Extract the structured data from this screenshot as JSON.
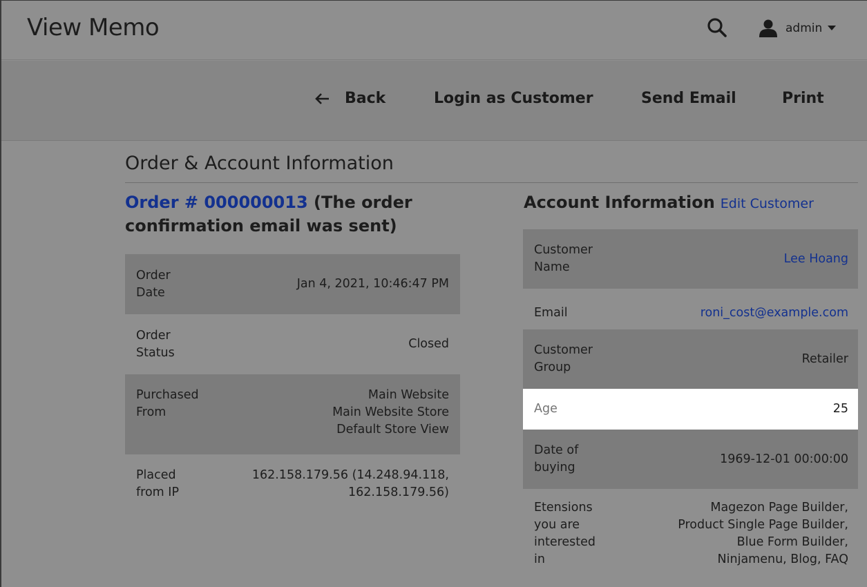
{
  "header": {
    "title": "View Memo",
    "search_icon": "search-icon",
    "user_name": "admin"
  },
  "actions": {
    "back": "Back",
    "login_as_customer": "Login as Customer",
    "send_email": "Send Email",
    "print": "Print"
  },
  "section": {
    "title": "Order & Account Information"
  },
  "order": {
    "link_text": "Order # 000000013",
    "note": " (The order confirmation email was sent)",
    "rows": [
      {
        "label": "Order Date",
        "value": "Jan 4, 2021, 10:46:47 PM"
      },
      {
        "label": "Order Status",
        "value": "Closed"
      },
      {
        "label": "Purchased From",
        "value": [
          "Main Website",
          "Main Website Store",
          "Default Store View"
        ]
      },
      {
        "label": "Placed from IP",
        "value": [
          "162.158.179.56 (14.248.94.118,",
          "162.158.179.56)"
        ]
      }
    ]
  },
  "account": {
    "title": "Account Information",
    "edit_link": "Edit Customer",
    "rows": [
      {
        "label": "Customer Name",
        "value": "Lee Hoang"
      },
      {
        "label": "Email",
        "value": "roni_cost@example.com"
      },
      {
        "label": "Customer Group",
        "value": "Retailer"
      },
      {
        "label": "Age",
        "value": "25"
      },
      {
        "label": "Date of buying",
        "value": "1969-12-01 00:00:00"
      },
      {
        "label": "Etensions you are interested in",
        "value": [
          "Magezon Page Builder,",
          "Product Single Page Builder,",
          "Blue Form Builder,",
          "Ninjamenu, Blog, FAQ"
        ]
      }
    ]
  },
  "colors": {
    "link": "#13318f",
    "overlay_bg": "#8f8f8f",
    "shaded_row": "#7c7c7c",
    "highlight_row": "#ffffff"
  }
}
